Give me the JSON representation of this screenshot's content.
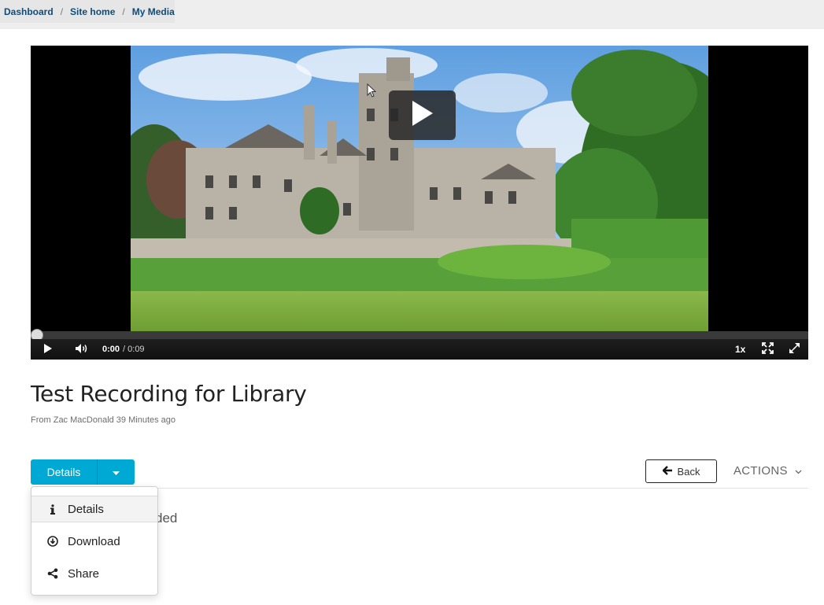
{
  "breadcrumb": {
    "items": [
      "Dashboard",
      "Site home",
      "My Media"
    ],
    "separator": "/"
  },
  "player": {
    "current_time": "0:00",
    "duration": "/ 0:09",
    "speed": "1x",
    "progress": 0,
    "icons": [
      "play-icon",
      "volume-icon",
      "fullscreen-icon",
      "expand-icon",
      "big-play-icon"
    ]
  },
  "media": {
    "title": "Test Recording for Library",
    "meta": "From Zac MacDonald 39 Minutes ago"
  },
  "tabs": {
    "details_label": "Details",
    "back_label": "Back",
    "actions_label": "ACTIONS"
  },
  "menu": {
    "items": [
      {
        "label": "Details",
        "icon": "info-icon"
      },
      {
        "label": "Download",
        "icon": "download-icon"
      },
      {
        "label": "Share",
        "icon": "share-icon"
      }
    ]
  },
  "behind_text": "ded",
  "colors": {
    "accent": "#00a8d4",
    "breadcrumb_link": "#0f4c7a",
    "topbar": "#eeeeee"
  }
}
